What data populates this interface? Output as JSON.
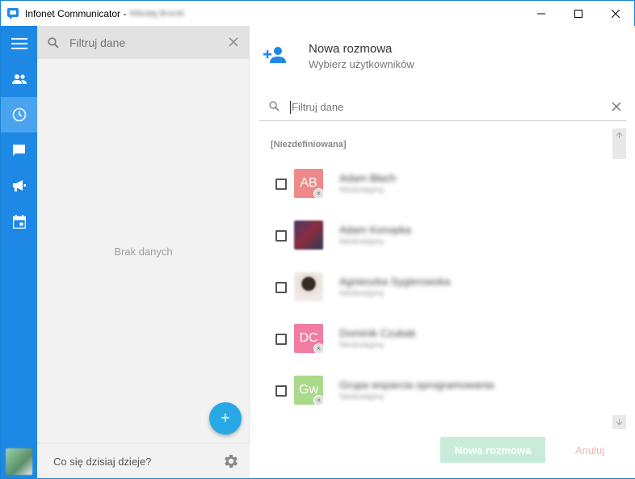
{
  "window": {
    "title": "Infonet Communicator -",
    "user_name": "Mikołaj Brocki"
  },
  "colors": {
    "rail": "#1e88e5",
    "accent": "#29a8e6",
    "primary_disabled": "#c8ecd9",
    "cancel_disabled": "#f4b3b3"
  },
  "rail": {
    "items": [
      {
        "icon": "menu-icon"
      },
      {
        "icon": "contacts-icon"
      },
      {
        "icon": "clock-icon",
        "active": true
      },
      {
        "icon": "chat-icon"
      },
      {
        "icon": "megaphone-icon"
      },
      {
        "icon": "calendar-icon"
      }
    ]
  },
  "conversations": {
    "search_placeholder": "Filtruj dane",
    "empty_text": "Brak danych",
    "fab_label": "+",
    "status_placeholder": "Co się dzisiaj dzieje?"
  },
  "new_conversation": {
    "title": "Nowa rozmowa",
    "subtitle": "Wybierz użytkowników",
    "search_placeholder": "Filtruj dane",
    "group_label": "[Niezdefiniowana]",
    "users": [
      {
        "initials": "AB",
        "name": "Adam Błach",
        "status": "Niedostępny",
        "color": "#ef8a8a"
      },
      {
        "initials": "",
        "name": "Adam Konopka",
        "status": "Niedostępny",
        "color": ""
      },
      {
        "initials": "",
        "name": "Agnieszka Sygierowska",
        "status": "Niedostępny",
        "color": ""
      },
      {
        "initials": "DC",
        "name": "Dominik Czubak",
        "status": "Niedostępny",
        "color": "#f07ca0"
      },
      {
        "initials": "Gw",
        "name": "Grupa wsparcia oprogramowania",
        "status": "Niedostępny",
        "color": "#a9d98a"
      }
    ],
    "primary_button": "Nowa rozmowa",
    "cancel_button": "Anuluj"
  }
}
